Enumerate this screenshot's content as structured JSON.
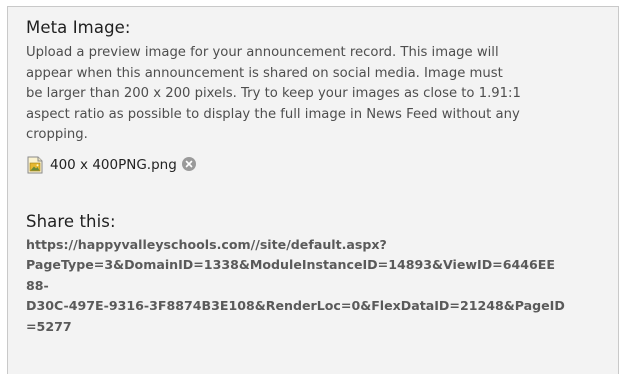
{
  "meta_image": {
    "title": "Meta Image:",
    "description": "Upload a preview image for your announcement record. This image will\nappear when this announcement is shared on social media. Image must\nbe larger than 200 x 200 pixels. Try to keep your images as close to 1.91:1\naspect ratio as possible to display the full image in News Feed without any\ncropping.",
    "file": {
      "name": "400 x 400PNG.png",
      "icon": "image-file-icon",
      "remove_icon": "remove-circle-icon"
    }
  },
  "share": {
    "title": "Share this:",
    "url": "https://happyvalleyschools.com//site/default.aspx?\nPageType=3&DomainID=1338&ModuleInstanceID=14893&ViewID=6446EE\n88-\nD30C-497E-9316-3F8874B3E108&RenderLoc=0&FlexDataID=21248&PageID\n=5277"
  },
  "colors": {
    "panel_background": "#f3f3f3",
    "panel_border": "#c9c9c9",
    "remove_icon": "#9a9a9a"
  }
}
